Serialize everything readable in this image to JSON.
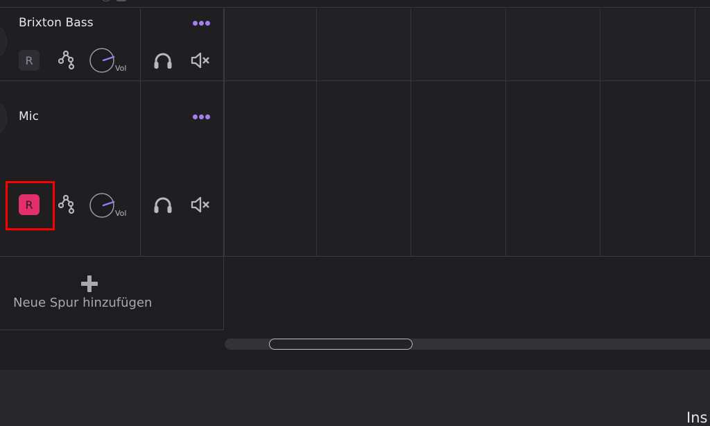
{
  "tracks": [
    {
      "name": "Brixton Bass",
      "record_label": "R",
      "record_armed": false,
      "volume_label": "Vol",
      "icons": [
        "more-options-icon",
        "automation-icon",
        "volume-knob-icon",
        "headphones-icon",
        "mute-icon"
      ]
    },
    {
      "name": "Mic",
      "record_label": "R",
      "record_armed": true,
      "volume_label": "Vol",
      "icons": [
        "more-options-icon",
        "automation-icon",
        "volume-knob-icon",
        "headphones-icon",
        "mute-icon"
      ]
    }
  ],
  "add_track": {
    "label": "Neue Spur hinzufügen",
    "icon": "plus-icon"
  },
  "bottom_panel": {
    "partial_label": "Ins"
  },
  "colors": {
    "accent_purple": "#a37ff0",
    "record_armed": "#e4306a",
    "highlight": "#ff0000"
  }
}
